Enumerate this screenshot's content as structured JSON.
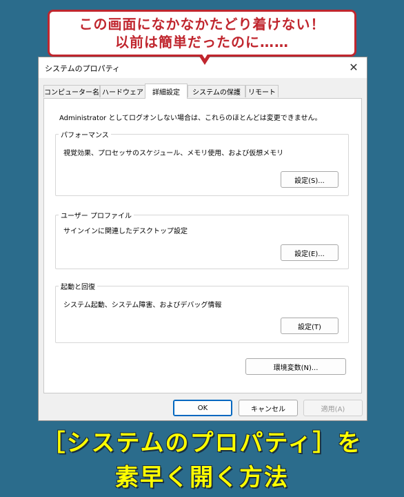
{
  "callout": {
    "line1": "この画面になかなかたどり着けない！",
    "line2": "以前は簡単だったのに……"
  },
  "dialog": {
    "title": "システムのプロパティ",
    "close_glyph": "✕",
    "tabs": [
      {
        "label": "コンピューター名"
      },
      {
        "label": "ハードウェア"
      },
      {
        "label": "詳細設定"
      },
      {
        "label": "システムの保護"
      },
      {
        "label": "リモート"
      }
    ],
    "notice": "Administrator としてログオンしない場合は、これらのほとんどは変更できません。",
    "performance": {
      "title": "パフォーマンス",
      "desc": "視覚効果、プロセッサのスケジュール、メモリ使用、および仮想メモリ",
      "button": "設定(S)..."
    },
    "user_profile": {
      "title": "ユーザー プロファイル",
      "desc": "サインインに関連したデスクトップ設定",
      "button": "設定(E)..."
    },
    "startup_recovery": {
      "title": "起動と回復",
      "desc": "システム起動、システム障害、およびデバッグ情報",
      "button": "設定(T)"
    },
    "env_button": "環境変数(N)...",
    "ok_button": "OK",
    "cancel_button": "キャンセル",
    "apply_button": "適用(A)"
  },
  "banner": {
    "line1": "［システムのプロパティ］を",
    "line2": "素早く開く方法"
  },
  "colors": {
    "background": "#2b6c8c",
    "callout_red": "#c0262e",
    "banner_yellow": "#ffff00",
    "accent_blue": "#0067c0"
  }
}
